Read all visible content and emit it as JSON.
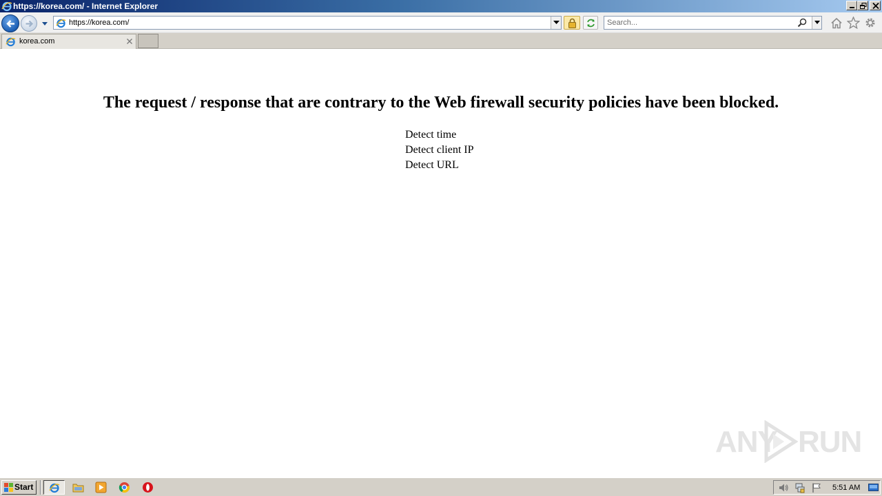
{
  "window": {
    "title": "https://korea.com/ - Internet Explorer",
    "controls": [
      "minimize",
      "restore",
      "close"
    ]
  },
  "navigation": {
    "address_url": "https://korea.com/",
    "search_placeholder": "Search...",
    "icons": [
      "back-arrow-icon",
      "forward-arrow-icon",
      "ie-logo-icon",
      "lock-icon",
      "refresh-icon",
      "search-icon",
      "home-icon",
      "star-icon",
      "gear-icon"
    ]
  },
  "tabs": [
    {
      "label": "korea.com",
      "active": true
    }
  ],
  "page": {
    "heading": "The request / response that are contrary to the Web firewall security policies have been blocked.",
    "detect_items": [
      "Detect time",
      "Detect client IP",
      "Detect URL"
    ]
  },
  "watermark": {
    "left": "ANY",
    "right": "RUN"
  },
  "taskbar": {
    "start_label": "Start",
    "pinned": [
      "internet-explorer",
      "file-explorer",
      "media-player",
      "chrome",
      "opera"
    ],
    "tray_icons": [
      "volume-icon",
      "network-icon",
      "flag-icon"
    ],
    "clock": "5:51 AM"
  },
  "colors": {
    "title_gradient_start": "#0a246a",
    "title_gradient_end": "#a6caf0",
    "chrome_gray": "#d4d0c8",
    "page_background": "#ffffff"
  }
}
